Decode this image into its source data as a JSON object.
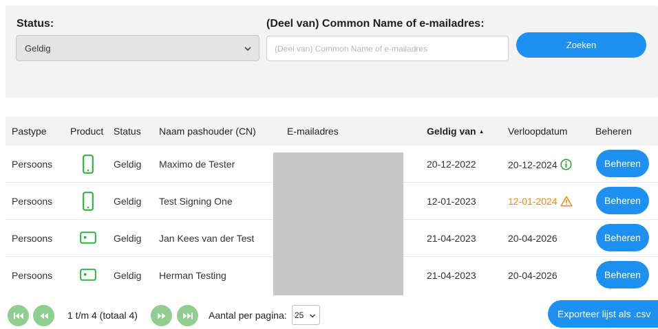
{
  "filters": {
    "status_label": "Status:",
    "status_value": "Geldig",
    "cn_label": "(Deel van) Common Name of e-mailadres:",
    "cn_placeholder": "(Deel van) Common Name of e-mailadres",
    "cn_value": "",
    "search_label": "Zoeken"
  },
  "table": {
    "headers": {
      "pastype": "Pastype",
      "product": "Product",
      "status": "Status",
      "name": "Naam pashouder (CN)",
      "email": "E-mailadres",
      "valid_from": "Geldig van",
      "expiry": "Verloopdatum",
      "manage": "Beheren"
    },
    "sorted_column": "Geldig van",
    "sort_direction": "ascending",
    "rows": [
      {
        "pastype": "Persoons",
        "product": "phone-icon",
        "status": "Geldig",
        "name": "Maximo de Tester",
        "valid_from": "20-12-2022",
        "expiry": "20-12-2024",
        "expiry_indicator": "info-icon",
        "manage_label": "Beheren"
      },
      {
        "pastype": "Persoons",
        "product": "phone-icon",
        "status": "Geldig",
        "name": "Test Signing One",
        "valid_from": "12-01-2023",
        "expiry": "12-01-2024",
        "expiry_indicator": "warning-icon",
        "manage_label": "Beheren"
      },
      {
        "pastype": "Persoons",
        "product": "card-icon",
        "status": "Geldig",
        "name": "Jan Kees van der Test",
        "valid_from": "21-04-2023",
        "expiry": "20-04-2026",
        "expiry_indicator": "",
        "manage_label": "Beheren"
      },
      {
        "pastype": "Persoons",
        "product": "card-icon",
        "status": "Geldig",
        "name": "Herman Testing",
        "valid_from": "21-04-2023",
        "expiry": "20-04-2026",
        "expiry_indicator": "",
        "manage_label": "Beheren"
      }
    ]
  },
  "pagination": {
    "range_text": "1 t/m 4 (totaal 4)",
    "per_page_label": "Aantal per pagina:",
    "per_page_value": "25"
  },
  "export_label": "Exporteer lijst als .csv",
  "colors": {
    "accent": "#1e90f0",
    "product_icon": "#2fb344",
    "info": "#2fa12f",
    "warning": "#f08a00",
    "pager": "#8fce8f"
  }
}
